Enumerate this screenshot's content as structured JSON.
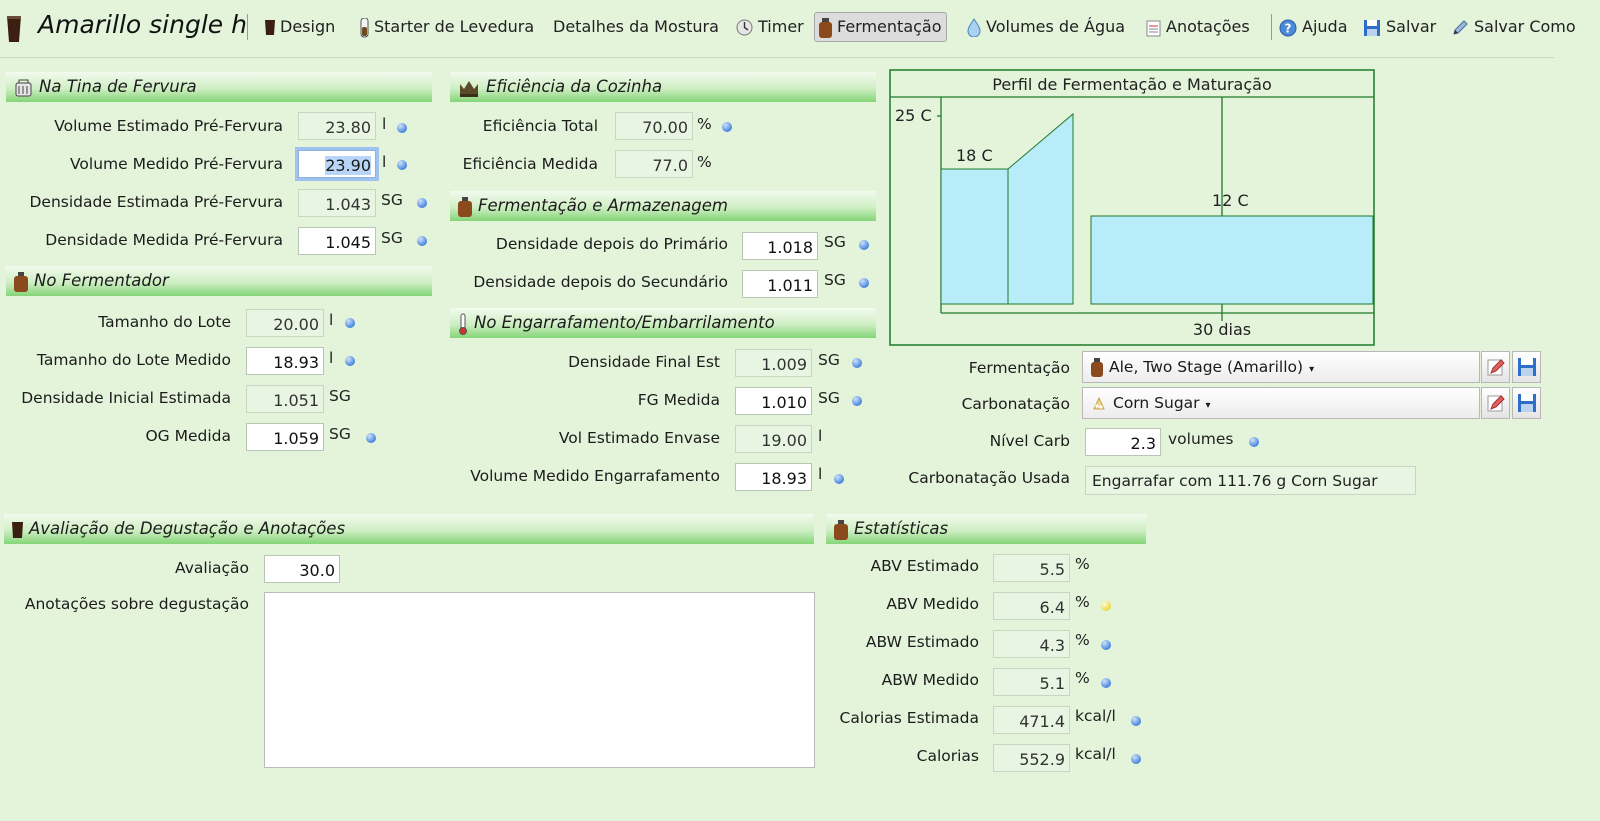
{
  "toolbar": {
    "title": "Amarillo single h",
    "design": "Design",
    "starter": "Starter de Levedura",
    "mash": "Detalhes da Mostura",
    "timer": "Timer",
    "fermentation": "Fermentação",
    "water": "Volumes de Água",
    "notes": "Anotações",
    "help": "Ajuda",
    "save": "Salvar",
    "save_as": "Salvar Como"
  },
  "boil": {
    "header": "Na Tina de Fervura",
    "est_pre_vol_label": "Volume Estimado Pré-Fervura",
    "est_pre_vol": "23.80",
    "est_pre_vol_unit": "l",
    "meas_pre_vol_label": "Volume Medido Pré-Fervura",
    "meas_pre_vol": "23.90",
    "meas_pre_vol_unit": "l",
    "est_pre_grav_label": "Densidade Estimada Pré-Fervura",
    "est_pre_grav": "1.043",
    "est_pre_grav_unit": "SG",
    "meas_pre_grav_label": "Densidade Medida Pré-Fervura",
    "meas_pre_grav": "1.045",
    "meas_pre_grav_unit": "SG"
  },
  "fermenter": {
    "header": "No Fermentador",
    "batch_label": "Tamanho do Lote",
    "batch": "20.00",
    "batch_unit": "l",
    "batch_meas_label": "Tamanho do Lote Medido",
    "batch_meas": "18.93",
    "batch_meas_unit": "l",
    "og_est_label": "Densidade Inicial Estimada",
    "og_est": "1.051",
    "og_est_unit": "SG",
    "og_meas_label": "OG Medida",
    "og_meas": "1.059",
    "og_meas_unit": "SG"
  },
  "efficiency": {
    "header": "Eficiência da Cozinha",
    "total_label": "Eficiência Total",
    "total": "70.00",
    "total_unit": "%",
    "measured_label": "Eficiência Medida",
    "measured": "77.0",
    "measured_unit": "%"
  },
  "ferm_storage": {
    "header": "Fermentação e Armazenagem",
    "primary_label": "Densidade depois do Primário",
    "primary": "1.018",
    "primary_unit": "SG",
    "secondary_label": "Densidade depois do Secundário",
    "secondary": "1.011",
    "secondary_unit": "SG"
  },
  "bottling": {
    "header": "No Engarrafamento/Embarrilamento",
    "fg_est_label": "Densidade Final Est",
    "fg_est": "1.009",
    "fg_est_unit": "SG",
    "fg_meas_label": "FG Medida",
    "fg_meas": "1.010",
    "fg_meas_unit": "SG",
    "vol_est_label": "Vol Estimado Envase",
    "vol_est": "19.00",
    "vol_est_unit": "l",
    "vol_meas_label": "Volume Medido Engarrafamento",
    "vol_meas": "18.93",
    "vol_meas_unit": "l"
  },
  "profile_chart": {
    "title": "Perfil de Fermentação e Maturação",
    "y_label": "25 C",
    "x_label": "30 dias",
    "label_18": "18 C",
    "label_12": "12 C"
  },
  "chart_data": {
    "type": "area",
    "title": "Perfil de Fermentação e Maturação",
    "xlabel": "30 dias",
    "ylabel": "25 C",
    "annotations": [
      "18 C",
      "12 C"
    ],
    "series": [
      {
        "segment": "primary",
        "temp_start": 18,
        "temp_end": 18
      },
      {
        "segment": "ramp",
        "temp_start": 18,
        "temp_end": 25
      },
      {
        "segment": "conditioning",
        "temp_start": 12,
        "temp_end": 12
      }
    ],
    "colors": {
      "fill": "#b9ecf9",
      "stroke": "#1f7a2b"
    }
  },
  "ferm_controls": {
    "fermentation_label": "Fermentação",
    "fermentation_value": "Ale, Two Stage (Amarillo)",
    "carbonation_label": "Carbonatação",
    "carbonation_value": "Corn Sugar",
    "carb_level_label": "Nível Carb",
    "carb_level": "2.3",
    "carb_level_unit": "volumes",
    "carb_used_label": "Carbonatação Usada",
    "carb_used": "Engarrafar com 111.76 g Corn Sugar"
  },
  "tasting": {
    "header": "Avaliação de Degustação e Anotações",
    "rating_label": "Avaliação",
    "rating": "30.0",
    "notes_label": "Anotações sobre degustação"
  },
  "stats": {
    "header": "Estatísticas",
    "abv_est_label": "ABV Estimado",
    "abv_est": "5.5",
    "abv_est_unit": "%",
    "abv_meas_label": "ABV Medido",
    "abv_meas": "6.4",
    "abv_meas_unit": "%",
    "abw_est_label": "ABW Estimado",
    "abw_est": "4.3",
    "abw_est_unit": "%",
    "abw_meas_label": "ABW Medido",
    "abw_meas": "5.1",
    "abw_meas_unit": "%",
    "cal_est_label": "Calorias Estimada",
    "cal_est": "471.4",
    "cal_est_unit": "kcal/l",
    "cal_label": "Calorias",
    "cal": "552.9",
    "cal_unit": "kcal/l"
  },
  "colors": {
    "accent_green": "#84d577",
    "background": "#e3f4da",
    "indicator_blue": "#3f7fdc",
    "indicator_yellow": "#e8d83a"
  }
}
